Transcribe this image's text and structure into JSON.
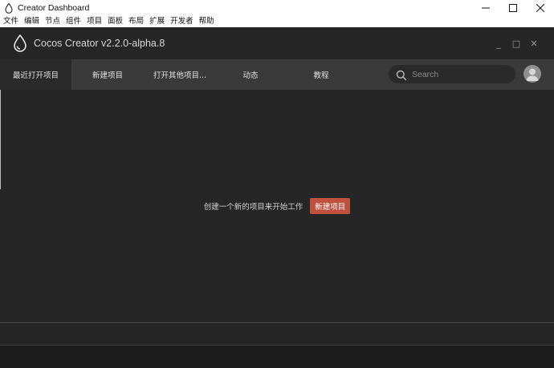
{
  "window": {
    "title": "Creator Dashboard",
    "controls": {
      "minimize": "—",
      "maximize": "☐",
      "close": "✕"
    }
  },
  "menu": {
    "items": [
      "文件",
      "编辑",
      "节点",
      "组件",
      "项目",
      "面板",
      "布局",
      "扩展",
      "开发者",
      "帮助"
    ]
  },
  "app": {
    "title": "Cocos Creator v2.2.0-alpha.8",
    "logo_icon": "cocos-droplet-icon",
    "controls": {
      "minimize": "_",
      "maximize": "□",
      "close": "✕"
    }
  },
  "tabs": [
    {
      "label": "最近打开项目",
      "active": true
    },
    {
      "label": "新建项目",
      "active": false
    },
    {
      "label": "打开其他项目...",
      "active": false
    },
    {
      "label": "动态",
      "active": false
    },
    {
      "label": "教程",
      "active": false
    }
  ],
  "search": {
    "placeholder": "Search",
    "value": ""
  },
  "empty_state": {
    "text": "创建一个新的项目来开始工作",
    "button_label": "新建项目"
  },
  "colors": {
    "background": "#262626",
    "tabbar": "#3a3a3a",
    "accent_button": "#c0513f"
  }
}
